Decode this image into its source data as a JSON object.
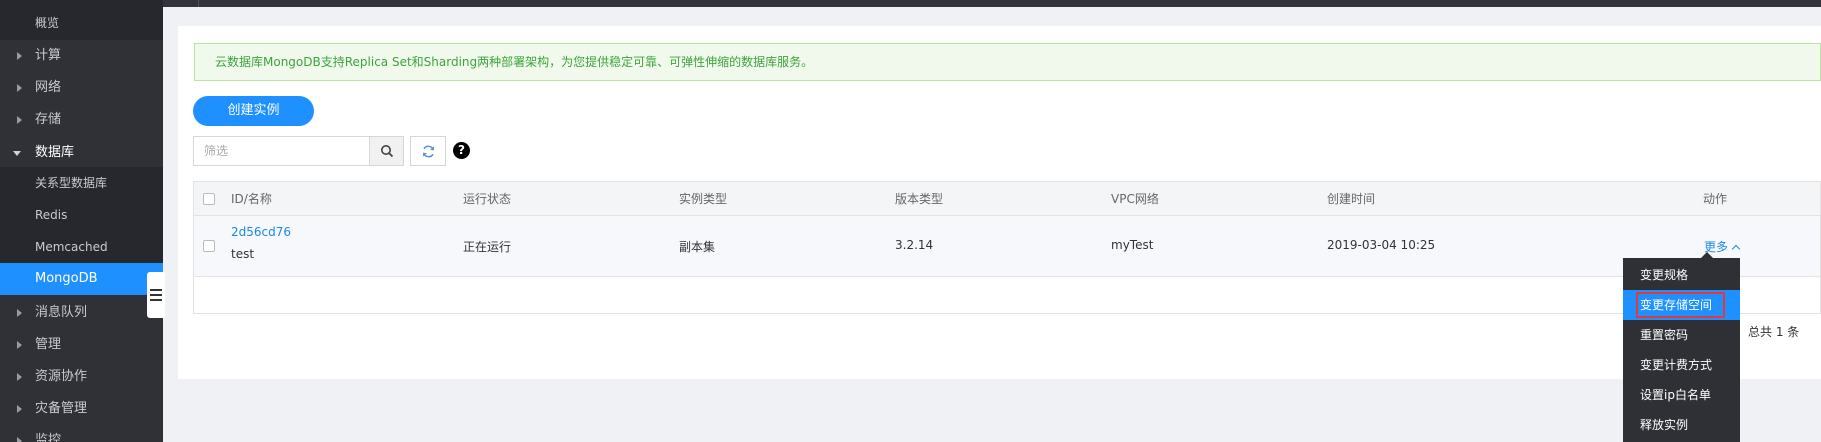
{
  "sidebar": {
    "items": [
      {
        "label": "概览",
        "type": "plain"
      },
      {
        "label": "计算",
        "type": "group"
      },
      {
        "label": "网络",
        "type": "group"
      },
      {
        "label": "存储",
        "type": "group"
      },
      {
        "label": "数据库",
        "type": "open"
      },
      {
        "label": "关系型数据库",
        "type": "sub"
      },
      {
        "label": "Redis",
        "type": "sub"
      },
      {
        "label": "Memcached",
        "type": "sub"
      },
      {
        "label": "MongoDB",
        "type": "active"
      },
      {
        "label": "消息队列",
        "type": "group"
      },
      {
        "label": "管理",
        "type": "group"
      },
      {
        "label": "资源协作",
        "type": "group"
      },
      {
        "label": "灾备管理",
        "type": "group"
      },
      {
        "label": "监控",
        "type": "group"
      }
    ]
  },
  "notice": {
    "text": "云数据库MongoDB支持Replica Set和Sharding两种部署架构，为您提供稳定可靠、可弹性伸缩的数据库服务。"
  },
  "toolbar": {
    "create_label": "创建实例",
    "filter_placeholder": "筛选",
    "help_label": "?"
  },
  "table": {
    "headers": {
      "id_name": "ID/名称",
      "status": "运行状态",
      "instance_type": "实例类型",
      "version_type": "版本类型",
      "vpc": "VPC网络",
      "created": "创建时间",
      "action": "动作"
    },
    "rows": [
      {
        "id": "2d56cd76",
        "name": "test",
        "status": "正在运行",
        "instance_type": "副本集",
        "version_type": "3.2.14",
        "vpc": "myTest",
        "created": "2019-03-04 10:25",
        "more_label": "更多"
      }
    ]
  },
  "pager": {
    "total": "总共 1 条"
  },
  "dropdown": {
    "items": [
      "变更规格",
      "变更存储空间",
      "重置密码",
      "变更计费方式",
      "设置ip白名单",
      "释放实例"
    ],
    "highlighted_index": 1
  },
  "colors": {
    "accent": "#1e90ff",
    "sidebar_bg": "#2f3137",
    "notice_text": "#3da43d",
    "highlight_outline": "#e53935"
  }
}
